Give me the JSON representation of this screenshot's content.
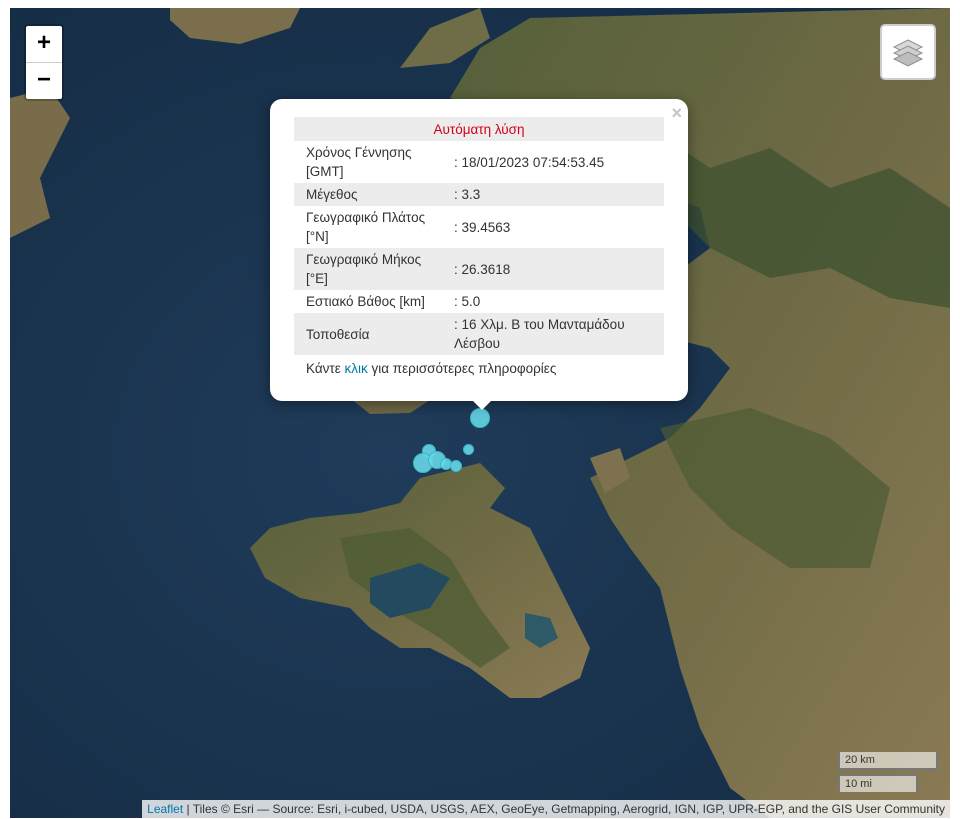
{
  "controls": {
    "zoom_in": "+",
    "zoom_out": "−",
    "layers_icon": "layers-icon"
  },
  "popup": {
    "header": "Αυτόματη λύση",
    "close": "×",
    "rows": [
      {
        "label": "Χρόνος Γέννησης [GMT]",
        "value": ": 18/01/2023 07:54:53.45"
      },
      {
        "label": "Μέγεθος",
        "value": ": 3.3"
      },
      {
        "label": "Γεωγραφικό Πλάτος [°N]",
        "value": ": 39.4563"
      },
      {
        "label": "Γεωγραφικό Μήκος [°E]",
        "value": ": 26.3618"
      },
      {
        "label": "Εστιακό Βάθος [km]",
        "value": ": 5.0"
      },
      {
        "label": "Τοποθεσία",
        "value": ": 16 Χλμ. Β του Μανταμάδου Λέσβου"
      }
    ],
    "more_before": "Κάντε ",
    "more_link": "κλικ",
    "more_after": " για περισσότερες πληροφορίες"
  },
  "scale": {
    "metric": "20 km",
    "imperial": "10 mi"
  },
  "attribution": {
    "leaflet": "Leaflet",
    "text": " | Tiles © Esri — Source: Esri, i-cubed, USDA, USGS, AEX, GeoEye, Getmapping, Aerogrid, IGN, IGP, UPR-EGP, and the GIS User Community"
  },
  "colors": {
    "sea": "#1b3550",
    "land": "#6d6a45",
    "marker": "#66d7e6",
    "header_text": "#d0021b",
    "link": "#0078a8"
  }
}
